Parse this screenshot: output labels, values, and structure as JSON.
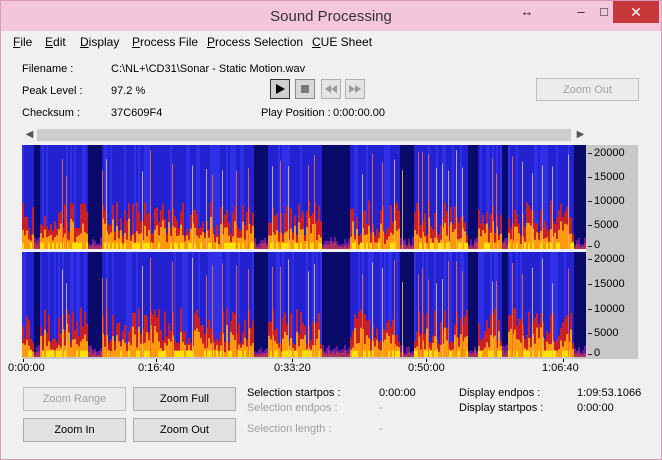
{
  "window": {
    "title": "Sound Processing",
    "controls": {
      "resize": "↔",
      "minimize": "–",
      "maximize": "□",
      "close": "✕"
    }
  },
  "menu": {
    "items": [
      {
        "label": "File",
        "accel": "F",
        "rest": "ile"
      },
      {
        "label": "Edit",
        "accel": "E",
        "rest": "dit"
      },
      {
        "label": "Display",
        "accel": "D",
        "rest": "isplay"
      },
      {
        "label": "Process File",
        "accel": "P",
        "rest": "rocess File"
      },
      {
        "label": "Process Selection",
        "accel": "P",
        "rest": "rocess Selection"
      },
      {
        "label": "CUE Sheet",
        "accel": "C",
        "rest": "UE Sheet"
      }
    ]
  },
  "info": {
    "filename_label": "Filename :",
    "filename_value": "C:\\NL+\\CD31\\Sonar - Static Motion.wav",
    "peak_label": "Peak Level :",
    "peak_value": "97.2 %",
    "checksum_label": "Checksum :",
    "checksum_value": "37C609F4",
    "play_position_label": "Play Position :",
    "play_position_value": "0:00:00.00"
  },
  "transport": {
    "icons": [
      "play-icon",
      "stop-icon",
      "rewind-icon",
      "fast-forward-icon"
    ]
  },
  "buttons": {
    "zoom_out_top": "Zoom Out",
    "zoom_range": "Zoom Range",
    "zoom_full": "Zoom Full",
    "zoom_in": "Zoom In",
    "zoom_out": "Zoom Out"
  },
  "scale": {
    "top": [
      "20000",
      "15000",
      "10000",
      "5000",
      "0"
    ],
    "bottom": [
      "20000",
      "15000",
      "10000",
      "5000",
      "0"
    ]
  },
  "timeline": {
    "ticks": [
      "0:00:00",
      "0:16:40",
      "0:33:20",
      "0:50:00",
      "1:06:40"
    ]
  },
  "selection": {
    "startpos_label": "Selection startpos :",
    "startpos_value": "0:00:00",
    "endpos_label": "Selection endpos :",
    "endpos_value": "-",
    "length_label": "Selection length :",
    "length_value": "-"
  },
  "display": {
    "endpos_label": "Display endpos :",
    "endpos_value": "1:09:53.1066",
    "startpos_label": "Display startpos :",
    "startpos_value": "0:00:00"
  },
  "colors": {
    "background": "#f0f0f0",
    "titlebar": "#f4c6d9",
    "close": "#c7383a",
    "spectrogram_low": "#1a1adc",
    "spectrogram_high": "#ffe000"
  }
}
